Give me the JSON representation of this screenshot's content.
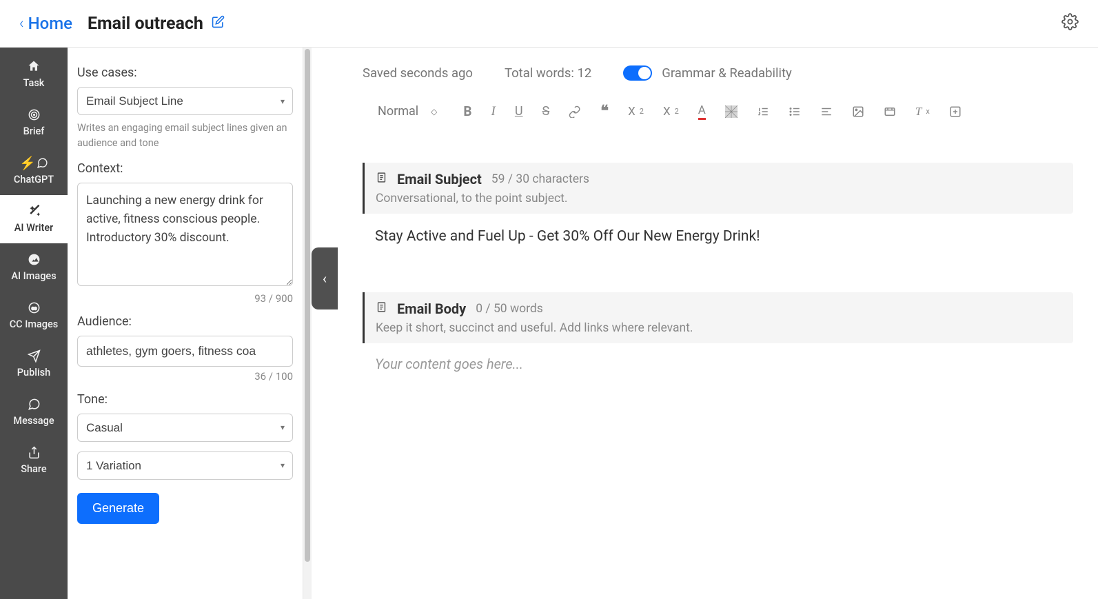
{
  "header": {
    "home_label": "Home",
    "title": "Email outreach"
  },
  "sidebar": {
    "items": [
      {
        "label": "Task"
      },
      {
        "label": "Brief"
      },
      {
        "label": "ChatGPT"
      },
      {
        "label": "AI Writer"
      },
      {
        "label": "AI Images"
      },
      {
        "label": "CC Images"
      },
      {
        "label": "Publish"
      },
      {
        "label": "Message"
      },
      {
        "label": "Share"
      }
    ]
  },
  "form": {
    "use_cases_label": "Use cases:",
    "use_case_selected": "Email Subject Line",
    "use_case_hint": "Writes an engaging email subject lines given an audience and tone",
    "context_label": "Context:",
    "context_value": "Launching a new energy drink for active, fitness conscious people. Introductory 30% discount.",
    "context_counter": "93 / 900",
    "audience_label": "Audience:",
    "audience_value": "athletes, gym goers, fitness coa",
    "audience_counter": "36 / 100",
    "tone_label": "Tone:",
    "tone_value": "Casual",
    "variation_value": "1 Variation",
    "generate_label": "Generate"
  },
  "editor": {
    "saved_text": "Saved seconds ago",
    "total_words": "Total words: 12",
    "grammar_label": "Grammar & Readability",
    "toolbar_style": "Normal",
    "blocks": [
      {
        "title": "Email Subject",
        "count": "59 / 30 characters",
        "sub": "Conversational, to the point subject.",
        "content": "Stay Active and Fuel Up - Get 30% Off Our New Energy Drink!"
      },
      {
        "title": "Email Body",
        "count": "0 / 50 words",
        "sub": "Keep it short, succinct and useful. Add links where relevant.",
        "placeholder": "Your content goes here..."
      }
    ]
  }
}
